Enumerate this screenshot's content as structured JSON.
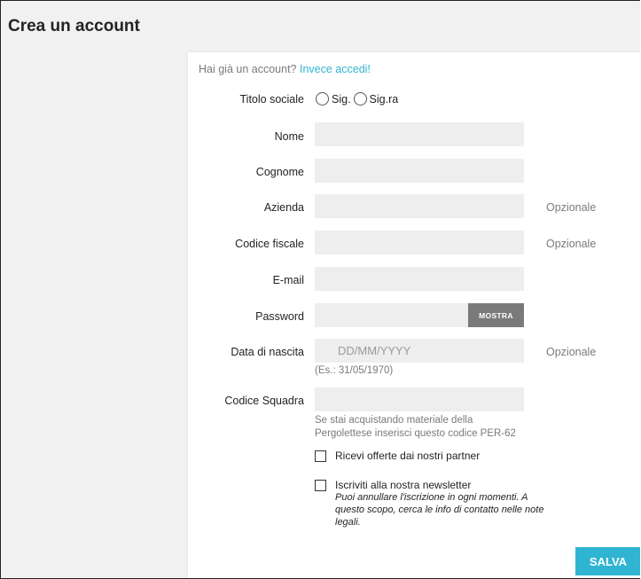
{
  "page": {
    "title": "Crea un account"
  },
  "login": {
    "prompt": "Hai già un account?",
    "link": "Invece accedi!"
  },
  "form": {
    "title_label": "Titolo sociale",
    "title_options": [
      "Sig.",
      "Sig.ra"
    ],
    "first_name_label": "Nome",
    "last_name_label": "Cognome",
    "company_label": "Azienda",
    "tax_code_label": "Codice fiscale",
    "email_label": "E-mail",
    "password_label": "Password",
    "show_password_label": "MOSTRA",
    "birthdate_label": "Data di nascita",
    "birthdate_placeholder": "DD/MM/YYYY",
    "birthdate_hint": "(Es.: 31/05/1970)",
    "team_code_label": "Codice Squadra",
    "team_code_hint_line1": "Se stai acquistando materiale della",
    "team_code_hint_line2": "Pergolettese inserisci questo codice PER-62",
    "optional_label": "Opzionale",
    "partner_offers_label": "Ricevi offerte dai nostri partner",
    "newsletter_label": "Iscriviti alla nostra newsletter",
    "newsletter_note": "Puoi annullare l'iscrizione in ogni momenti. A questo scopo, cerca le info di contatto nelle note legali.",
    "save_label": "SALVA"
  },
  "colors": {
    "accent": "#2fb5d2",
    "field_bg": "#eeeeee",
    "page_bg": "#f1f1f1",
    "muted_button": "#7a7a7a"
  }
}
